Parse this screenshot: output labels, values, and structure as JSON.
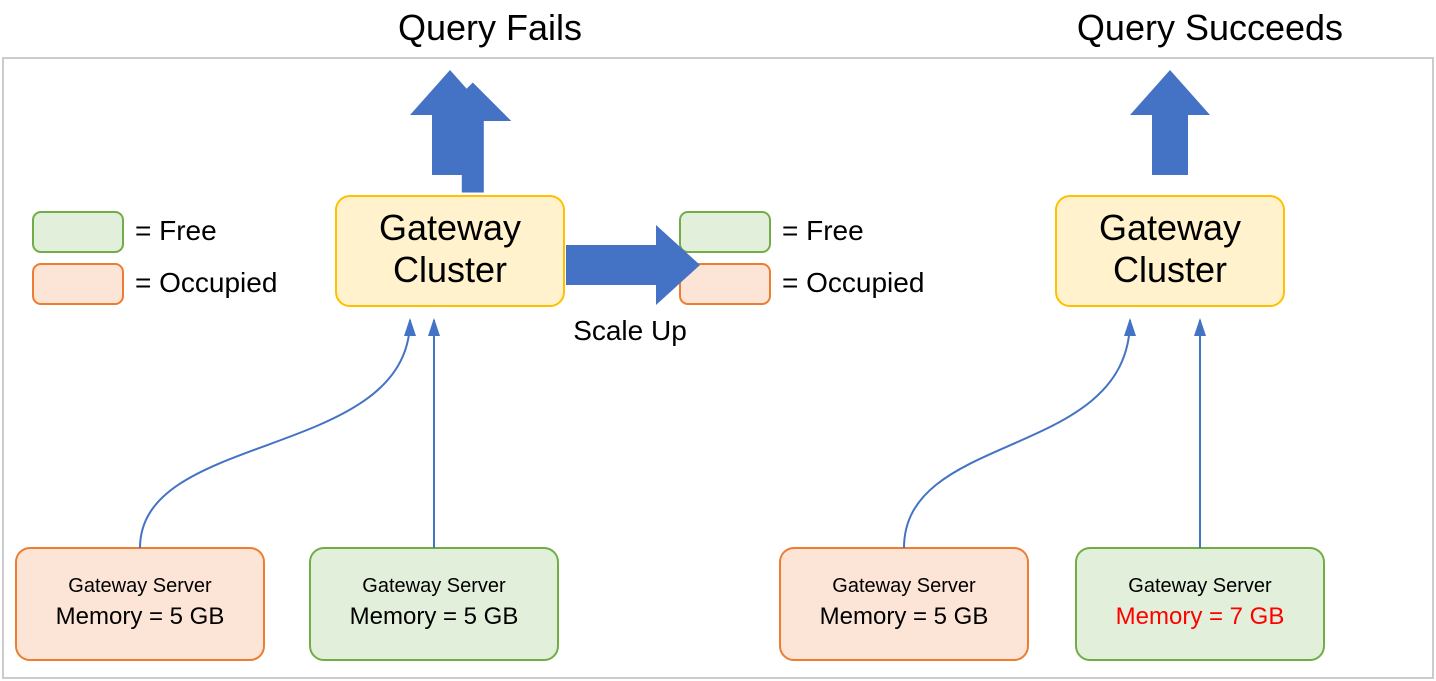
{
  "colors": {
    "free_fill": "#E2EFDA",
    "free_stroke": "#70AD47",
    "occ_fill": "#FCE4D6",
    "occ_stroke": "#ED7D31",
    "cluster_fill": "#FFF2CC",
    "cluster_stroke": "#FFC000",
    "arrow": "#4472C4"
  },
  "left": {
    "title": "Query Fails",
    "cluster": "Gateway Cluster",
    "legend_free": "= Free",
    "legend_occ": "= Occupied",
    "server1": {
      "title": "Gateway Server",
      "mem": "Memory = 5 GB",
      "state": "occ",
      "mem_color": "#000"
    },
    "server2": {
      "title": "Gateway Server",
      "mem": "Memory = 5 GB",
      "state": "free",
      "mem_color": "#000"
    }
  },
  "transition": "Scale Up",
  "right": {
    "title": "Query Succeeds",
    "cluster": "Gateway Cluster",
    "legend_free": "= Free",
    "legend_occ": "= Occupied",
    "server1": {
      "title": "Gateway Server",
      "mem": "Memory = 5 GB",
      "state": "occ",
      "mem_color": "#000"
    },
    "server2": {
      "title": "Gateway Server",
      "mem": "Memory =  7 GB",
      "state": "free",
      "mem_color": "#FF0000"
    }
  }
}
